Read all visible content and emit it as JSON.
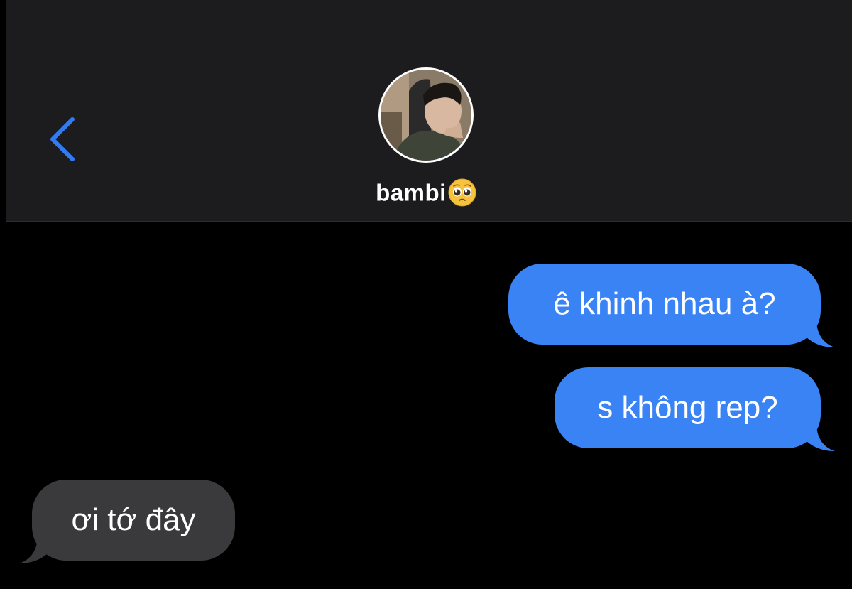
{
  "header": {
    "contact_name": "bambi",
    "name_emoji": "pleading-face-emoji",
    "avatar": "contact-avatar-photo",
    "back_icon": "chevron-left-icon"
  },
  "messages": [
    {
      "direction": "sent",
      "text": "ê khinh nhau à?"
    },
    {
      "direction": "sent",
      "text": "s không rep?"
    },
    {
      "direction": "received",
      "text": "ơi tớ đây"
    }
  ],
  "colors": {
    "header_bg": "#1c1c1e",
    "background": "#000000",
    "sent_bubble": "#3a83f5",
    "received_bubble": "#3a3a3c",
    "accent": "#2f7cf6"
  }
}
